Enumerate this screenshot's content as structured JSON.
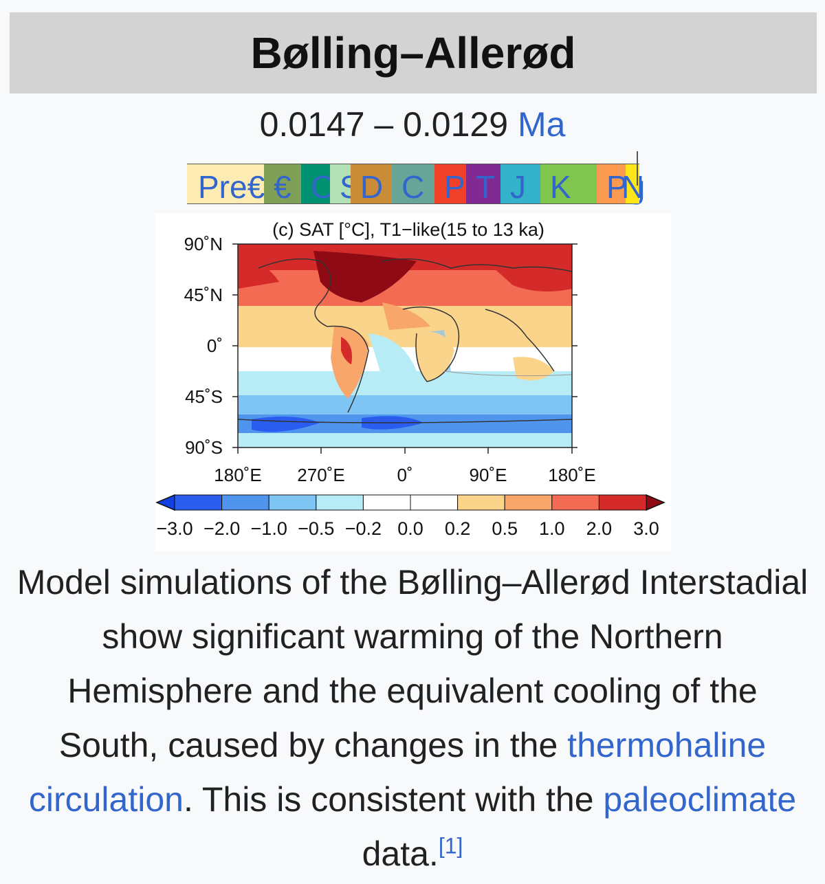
{
  "infobox": {
    "title": "Bølling–Allerød",
    "range_text": "0.0147 – 0.0129",
    "range_unit_link": "Ma"
  },
  "timeline": {
    "segments": [
      {
        "label": "Pre€",
        "color": "#fcecb4"
      },
      {
        "label": "€",
        "color": "#7fa056"
      },
      {
        "label": "O",
        "color": "#009270"
      },
      {
        "label": "S",
        "color": "#b3e1b6"
      },
      {
        "label": "D",
        "color": "#cb8c37"
      },
      {
        "label": "C",
        "color": "#67a599"
      },
      {
        "label": "P",
        "color": "#f04028"
      },
      {
        "label": "T",
        "color": "#812b92"
      },
      {
        "label": "J",
        "color": "#34b2c9"
      },
      {
        "label": "K",
        "color": "#7fc64e"
      },
      {
        "label": "Pg",
        "color": "#fd9a52"
      },
      {
        "label": "N",
        "color": "#ffe619"
      }
    ]
  },
  "figure": {
    "title": "(c) SAT [°C], T1−like(15 to 13 ka)",
    "y_ticks": [
      "90˚N",
      "45˚N",
      "0˚",
      "45˚S",
      "90˚S"
    ],
    "x_ticks": [
      "180˚E",
      "270˚E",
      "0˚",
      "90˚E",
      "180˚E"
    ],
    "colorbar_labels": [
      "−3.0",
      "−2.0",
      "−1.0",
      "−0.5",
      "−0.2",
      "0.0",
      "0.2",
      "0.5",
      "1.0",
      "2.0",
      "3.0"
    ],
    "colorbar_colors": [
      "#2a5cf0",
      "#4f95ee",
      "#7fc5f4",
      "#b7ecf7",
      "#ffffff",
      "#ffffff",
      "#fbd48c",
      "#f9a66a",
      "#f26b52",
      "#d42a2a"
    ],
    "colorbar_min_color": "#1340e0",
    "colorbar_max_color": "#8e0a14"
  },
  "caption": {
    "text_1": "Model simulations of the Bølling–Allerød Interstadial show significant warming of the Northern Hemisphere and the equivalent cooling of the South, caused by changes in the ",
    "link_1": "thermohaline circulation",
    "text_2": ". This is consistent with the ",
    "link_2": "paleoclimate",
    "text_3": " data.",
    "ref": "[1]"
  }
}
